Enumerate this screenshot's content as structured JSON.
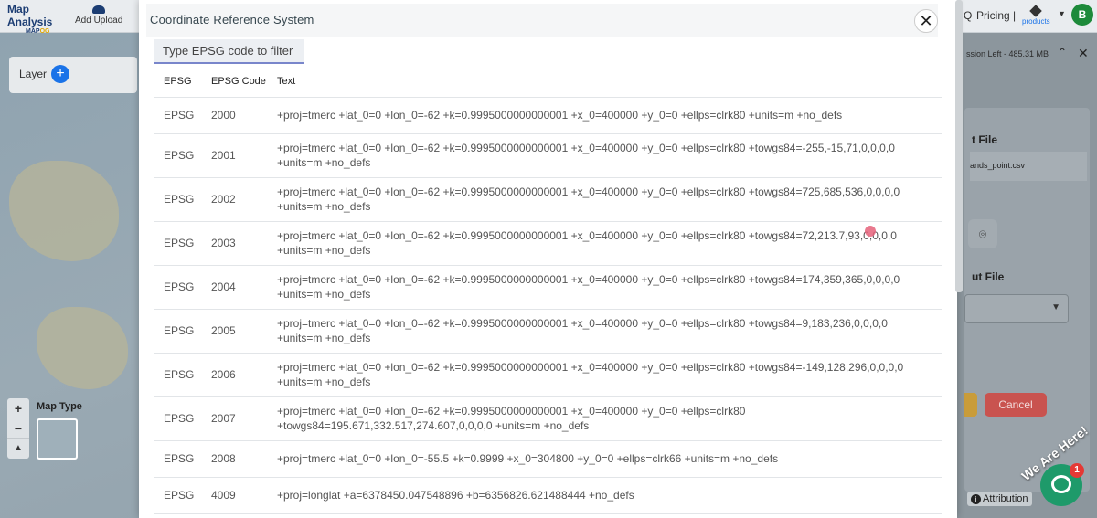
{
  "header": {
    "logo_title": "Map Analysis",
    "logo_sub_a": "MAP",
    "logo_sub_b": "OG",
    "add_upload": "Add Upload",
    "q": "Q",
    "pricing": "Pricing |",
    "products": "products",
    "avatar": "B"
  },
  "left_panel": {
    "layer": "Layer",
    "add": "+",
    "zoom_in": "+",
    "zoom_out": "−",
    "reset": "▲",
    "map_type": "Map Type"
  },
  "right_panel": {
    "session": "ssion Left - 485.31 MB",
    "input_file": "t File",
    "file_name": "ands_point.csv",
    "output_file": "ut File",
    "cancel": "Cancel"
  },
  "attribution": "Attribution",
  "chat": {
    "tagline": "We Are Here!",
    "badge": "1"
  },
  "modal": {
    "title": "Coordinate Reference System",
    "close": "✕",
    "filter_placeholder": "Type EPSG code to filter",
    "columns": [
      "EPSG",
      "EPSG Code",
      "Text"
    ],
    "rows": [
      {
        "epsg": "EPSG",
        "code": "2000",
        "text": "+proj=tmerc +lat_0=0 +lon_0=-62 +k=0.9995000000000001 +x_0=400000 +y_0=0 +ellps=clrk80 +units=m +no_defs"
      },
      {
        "epsg": "EPSG",
        "code": "2001",
        "text": "+proj=tmerc +lat_0=0 +lon_0=-62 +k=0.9995000000000001 +x_0=400000 +y_0=0 +ellps=clrk80 +towgs84=-255,-15,71,0,0,0,0 +units=m +no_defs"
      },
      {
        "epsg": "EPSG",
        "code": "2002",
        "text": "+proj=tmerc +lat_0=0 +lon_0=-62 +k=0.9995000000000001 +x_0=400000 +y_0=0 +ellps=clrk80 +towgs84=725,685,536,0,0,0,0 +units=m +no_defs"
      },
      {
        "epsg": "EPSG",
        "code": "2003",
        "text": "+proj=tmerc +lat_0=0 +lon_0=-62 +k=0.9995000000000001 +x_0=400000 +y_0=0 +ellps=clrk80 +towgs84=72,213.7,93,0,0,0,0 +units=m +no_defs"
      },
      {
        "epsg": "EPSG",
        "code": "2004",
        "text": "+proj=tmerc +lat_0=0 +lon_0=-62 +k=0.9995000000000001 +x_0=400000 +y_0=0 +ellps=clrk80 +towgs84=174,359,365,0,0,0,0 +units=m +no_defs"
      },
      {
        "epsg": "EPSG",
        "code": "2005",
        "text": "+proj=tmerc +lat_0=0 +lon_0=-62 +k=0.9995000000000001 +x_0=400000 +y_0=0 +ellps=clrk80 +towgs84=9,183,236,0,0,0,0 +units=m +no_defs"
      },
      {
        "epsg": "EPSG",
        "code": "2006",
        "text": "+proj=tmerc +lat_0=0 +lon_0=-62 +k=0.9995000000000001 +x_0=400000 +y_0=0 +ellps=clrk80 +towgs84=-149,128,296,0,0,0,0 +units=m +no_defs"
      },
      {
        "epsg": "EPSG",
        "code": "2007",
        "text": "+proj=tmerc +lat_0=0 +lon_0=-62 +k=0.9995000000000001 +x_0=400000 +y_0=0 +ellps=clrk80 +towgs84=195.671,332.517,274.607,0,0,0,0 +units=m +no_defs"
      },
      {
        "epsg": "EPSG",
        "code": "2008",
        "text": "+proj=tmerc +lat_0=0 +lon_0=-55.5 +k=0.9999 +x_0=304800 +y_0=0 +ellps=clrk66 +units=m +no_defs"
      },
      {
        "epsg": "EPSG",
        "code": "4009",
        "text": "+proj=longlat +a=6378450.047548896 +b=6356826.621488444 +no_defs"
      }
    ]
  },
  "colors": {
    "accent": "#1a73e8",
    "avatar": "#1d8a3a",
    "cancel": "#c9534f",
    "chat": "#1e9a6a",
    "filter_underline": "#7986cb"
  }
}
